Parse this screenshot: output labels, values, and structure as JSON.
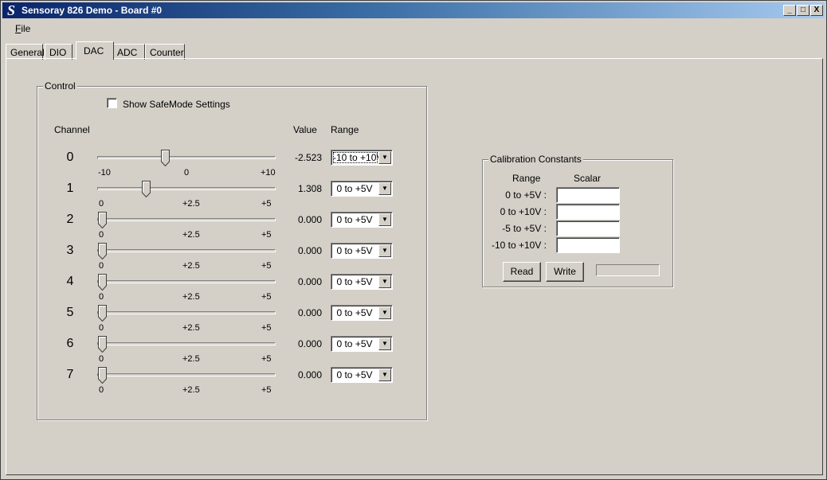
{
  "window": {
    "title": "Sensoray 826 Demo - Board #0",
    "logo_letter": "S",
    "buttons": [
      "_",
      "□",
      "X"
    ]
  },
  "menu": {
    "items": [
      {
        "label_ul": "F",
        "label_rest": "ile"
      }
    ]
  },
  "tabs": [
    "General",
    "DIO",
    "DAC",
    "ADC",
    "Counter"
  ],
  "active_tab": "DAC",
  "control": {
    "title": "Control",
    "safemode_label": "Show SafeMode Settings",
    "safemode_checked": false,
    "headers": {
      "channel": "Channel",
      "value": "Value",
      "range": "Range"
    },
    "channels": [
      {
        "num": "0",
        "ticks": [
          "-10",
          "0",
          "+10"
        ],
        "value": "-2.523",
        "range": "-10 to +10V",
        "level": 0.3738
      },
      {
        "num": "1",
        "ticks": [
          "0",
          "+2.5",
          "+5"
        ],
        "value": "1.308",
        "range": "0 to +5V",
        "level": 0.2616
      },
      {
        "num": "2",
        "ticks": [
          "0",
          "+2.5",
          "+5"
        ],
        "value": "0.000",
        "range": "0 to +5V",
        "level": 0
      },
      {
        "num": "3",
        "ticks": [
          "0",
          "+2.5",
          "+5"
        ],
        "value": "0.000",
        "range": "0 to +5V",
        "level": 0
      },
      {
        "num": "4",
        "ticks": [
          "0",
          "+2.5",
          "+5"
        ],
        "value": "0.000",
        "range": "0 to +5V",
        "level": 0
      },
      {
        "num": "5",
        "ticks": [
          "0",
          "+2.5",
          "+5"
        ],
        "value": "0.000",
        "range": "0 to +5V",
        "level": 0
      },
      {
        "num": "6",
        "ticks": [
          "0",
          "+2.5",
          "+5"
        ],
        "value": "0.000",
        "range": "0 to +5V",
        "level": 0
      },
      {
        "num": "7",
        "ticks": [
          "0",
          "+2.5",
          "+5"
        ],
        "value": "0.000",
        "range": "0 to +5V",
        "level": 0
      }
    ]
  },
  "calibration": {
    "title": "Calibration Constants",
    "headers": {
      "range": "Range",
      "scalar": "Scalar"
    },
    "rows": [
      {
        "label": "0 to +5V :",
        "value": ""
      },
      {
        "label": "0 to +10V :",
        "value": ""
      },
      {
        "label": "-5 to +5V :",
        "value": ""
      },
      {
        "label": "-10 to +10V :",
        "value": ""
      }
    ],
    "read_label": "Read",
    "write_label": "Write",
    "progress": 0
  }
}
